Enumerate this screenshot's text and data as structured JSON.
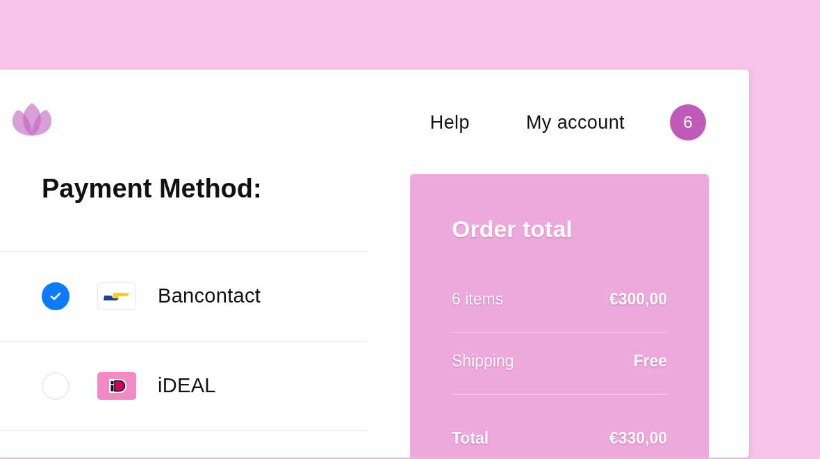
{
  "header": {
    "nav_links": [
      "Help",
      "My account"
    ],
    "cart_count": "6"
  },
  "payment": {
    "title": "Payment Method:",
    "methods": [
      {
        "name": "Bancontact",
        "kind": "bancontact",
        "selected": true
      },
      {
        "name": "iDEAL",
        "kind": "ideal",
        "selected": false
      }
    ]
  },
  "order": {
    "title": "Order total",
    "rows": [
      {
        "label": "6 items",
        "value": "€300,00",
        "kind": "line"
      },
      {
        "label": "Shipping",
        "value": "Free",
        "kind": "line"
      },
      {
        "label": "Total",
        "value": "€330,00",
        "kind": "total"
      }
    ]
  }
}
